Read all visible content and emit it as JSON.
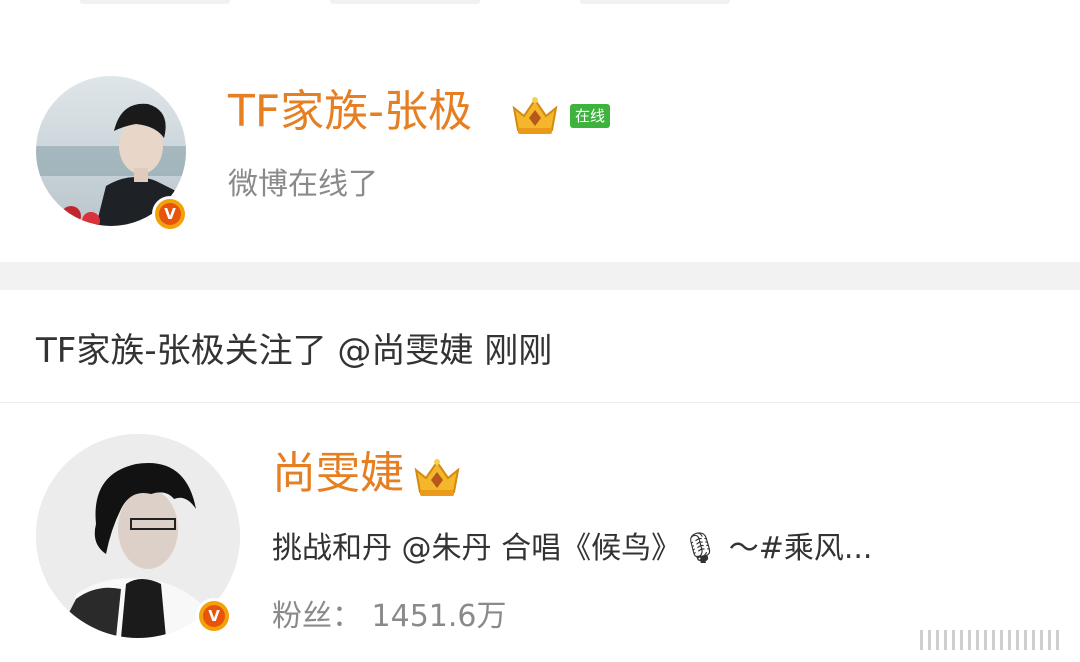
{
  "user_card": {
    "name": "TF家族-张极",
    "online_badge": "在线",
    "status": "微博在线了"
  },
  "activity": {
    "text": "TF家族-张极关注了 @尚雯婕 刚刚"
  },
  "followed_card": {
    "name": "尚雯婕",
    "description": "挑战和丹 @朱丹 合唱《候鸟》🎙 ～#乘风...",
    "fans": "粉丝： 1451.6万"
  },
  "colors": {
    "name_orange": "#e67e22",
    "verify_orange": "#f3a10b",
    "online_green": "#3db33d",
    "divider_gray": "#f2f2f2"
  },
  "icons": {
    "verified": "verified-badge-icon",
    "crown": "vip-crown-icon",
    "mic": "microphone-icon"
  }
}
